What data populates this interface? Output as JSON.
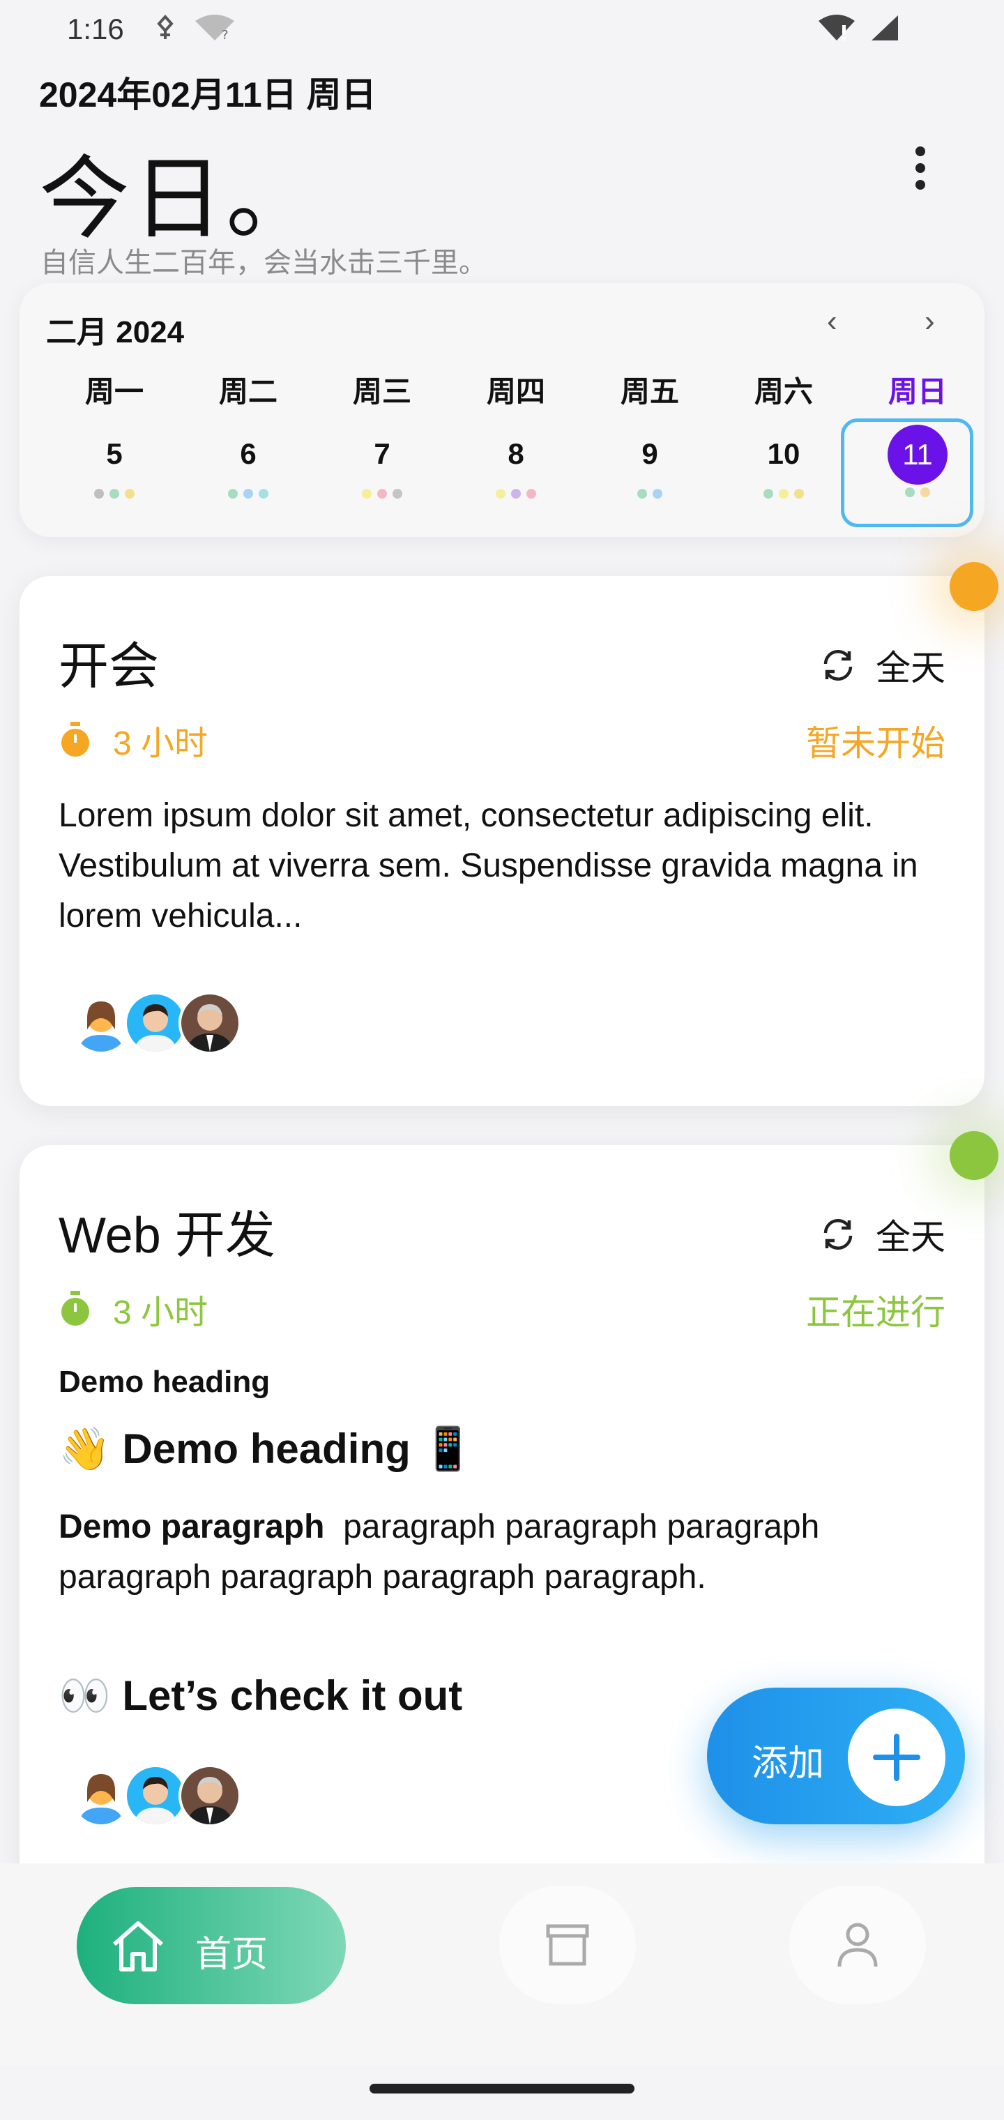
{
  "status": {
    "time": "1:16"
  },
  "header": {
    "date": "2024年02月11日 周日",
    "title": "今日。",
    "subtitle": "自信人生二百年，会当水击三千里。"
  },
  "calendar": {
    "month": "二月 2024",
    "weekdays": [
      "周一",
      "周二",
      "周三",
      "周四",
      "周五",
      "周六",
      "周日"
    ],
    "days": [
      "5",
      "6",
      "7",
      "8",
      "9",
      "10",
      "11"
    ],
    "selected_index": 6,
    "selected_color": "#6a12e8"
  },
  "cards": [
    {
      "title": "开会",
      "allday": "全天",
      "duration": "3 小时",
      "status": "暂未开始",
      "accent": "#f5a623",
      "body": "Lorem ipsum dolor sit amet, consectetur adipiscing elit. Vestibulum at viverra sem. Suspendisse gravida magna in lorem vehicula..."
    },
    {
      "title": "Web 开发",
      "allday": "全天",
      "duration": "3 小时",
      "status": "正在进行",
      "accent": "#8cc63e",
      "md_h6": "Demo heading",
      "md_h3": "👋 Demo heading 📱",
      "md_para_bold": "Demo paragraph",
      "md_para_rest": "paragraph paragraph paragraph paragraph paragraph paragraph paragraph.",
      "md_h3b": "👀 Let’s check it out"
    }
  ],
  "fab": {
    "label": "添加"
  },
  "nav": {
    "home_label": "首页"
  }
}
